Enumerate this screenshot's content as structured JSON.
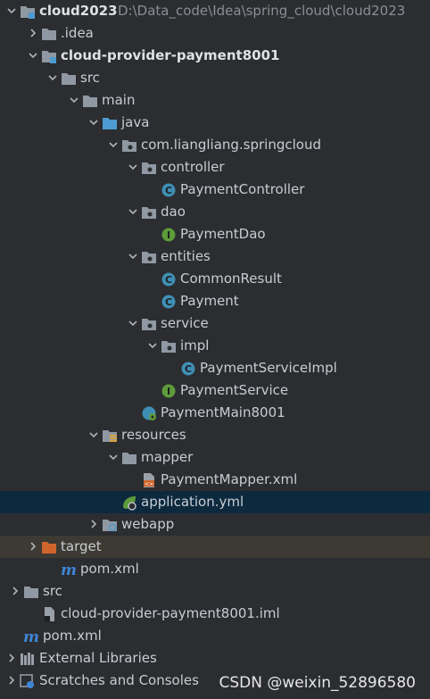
{
  "colors": {
    "background": "#2b2d30",
    "selected_row": "#0d293e",
    "excluded_row": "#3d3a34",
    "folder": "#8f98a3",
    "source_folder": "#4e9bd1",
    "excluded_folder": "#d0652b",
    "class_icon": "#3f8fb5",
    "interface_icon": "#5e9c3b",
    "maven": "#3e86d6"
  },
  "tree": [
    {
      "label": "cloud2023",
      "path": "D:\\Data_code\\Idea\\spring_cloud\\cloud2023",
      "icon": "module-folder-icon",
      "arrow": "down",
      "bold": true
    },
    {
      "label": ".idea",
      "icon": "folder-icon",
      "arrow": "right"
    },
    {
      "label": "cloud-provider-payment8001",
      "icon": "module-folder-icon",
      "arrow": "down",
      "bold": true
    },
    {
      "label": "src",
      "icon": "folder-icon",
      "arrow": "down"
    },
    {
      "label": "main",
      "icon": "folder-icon",
      "arrow": "down"
    },
    {
      "label": "java",
      "icon": "source-folder-icon",
      "arrow": "down"
    },
    {
      "label": "com.liangliang.springcloud",
      "icon": "package-icon",
      "arrow": "down"
    },
    {
      "label": "controller",
      "icon": "package-icon",
      "arrow": "down"
    },
    {
      "label": "PaymentController",
      "icon": "class-icon"
    },
    {
      "label": "dao",
      "icon": "package-icon",
      "arrow": "down"
    },
    {
      "label": "PaymentDao",
      "icon": "interface-icon"
    },
    {
      "label": "entities",
      "icon": "package-icon",
      "arrow": "down"
    },
    {
      "label": "CommonResult",
      "icon": "class-icon"
    },
    {
      "label": "Payment",
      "icon": "class-icon"
    },
    {
      "label": "service",
      "icon": "package-icon",
      "arrow": "down"
    },
    {
      "label": "impl",
      "icon": "package-icon",
      "arrow": "down"
    },
    {
      "label": "PaymentServiceImpl",
      "icon": "class-icon"
    },
    {
      "label": "PaymentService",
      "icon": "interface-icon"
    },
    {
      "label": "PaymentMain8001",
      "icon": "spring-boot-class-icon"
    },
    {
      "label": "resources",
      "icon": "resources-folder-icon",
      "arrow": "down"
    },
    {
      "label": "mapper",
      "icon": "folder-icon",
      "arrow": "down"
    },
    {
      "label": "PaymentMapper.xml",
      "icon": "xml-file-icon"
    },
    {
      "label": "application.yml",
      "icon": "spring-yml-icon",
      "selected": true
    },
    {
      "label": "webapp",
      "icon": "web-folder-icon",
      "arrow": "right"
    },
    {
      "label": "target",
      "icon": "excluded-folder-icon",
      "arrow": "right",
      "excluded": true
    },
    {
      "label": "pom.xml",
      "icon": "maven-icon"
    },
    {
      "label": "src",
      "icon": "folder-icon",
      "arrow": "right"
    },
    {
      "label": "cloud-provider-payment8001.iml",
      "icon": "iml-file-icon"
    },
    {
      "label": "pom.xml",
      "icon": "maven-icon"
    },
    {
      "label": "External Libraries",
      "icon": "libraries-icon",
      "arrow": "right"
    },
    {
      "label": "Scratches and Consoles",
      "icon": "scratches-icon",
      "arrow": "right"
    }
  ],
  "watermark": "CSDN @weixin_52896580"
}
